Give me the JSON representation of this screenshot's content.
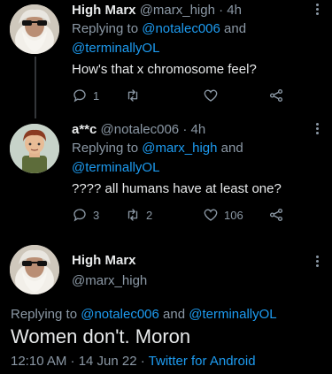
{
  "tweets": [
    {
      "display_name": "High Marx",
      "handle": "@marx_high",
      "time": "· 4h",
      "replying_prefix": "Replying to ",
      "replying_to_1": "@notalec006",
      "replying_and": " and",
      "replying_to_2": "@terminallyOL",
      "text": "How's that x chromosome feel?",
      "reply_count": "1",
      "retweet_count": "",
      "like_count": ""
    },
    {
      "display_name": "a**c",
      "handle": "@notalec006",
      "time": "· 4h",
      "replying_prefix": "Replying to ",
      "replying_to_1": "@marx_high",
      "replying_and": " and",
      "replying_to_2": "@terminallyOL",
      "text": "???? all humans have at least one?",
      "reply_count": "3",
      "retweet_count": "2",
      "like_count": "106"
    }
  ],
  "main_tweet": {
    "display_name": "High Marx",
    "handle": "@marx_high",
    "replying_prefix": "Replying to ",
    "replying_to_1": "@notalec006",
    "replying_and": " and ",
    "replying_to_2": "@terminallyOL",
    "text": "Women don't. Moron",
    "timestamp": "12:10 AM · 14 Jun 22 · ",
    "source": "Twitter for Android"
  },
  "icons": {
    "reply": "reply-icon",
    "retweet": "retweet-icon",
    "like": "heart-icon",
    "share": "share-icon",
    "more": "more-icon"
  },
  "colors": {
    "background": "#000000",
    "text": "#e7e9ea",
    "muted": "#8b98a5",
    "link": "#1d9bf0"
  }
}
